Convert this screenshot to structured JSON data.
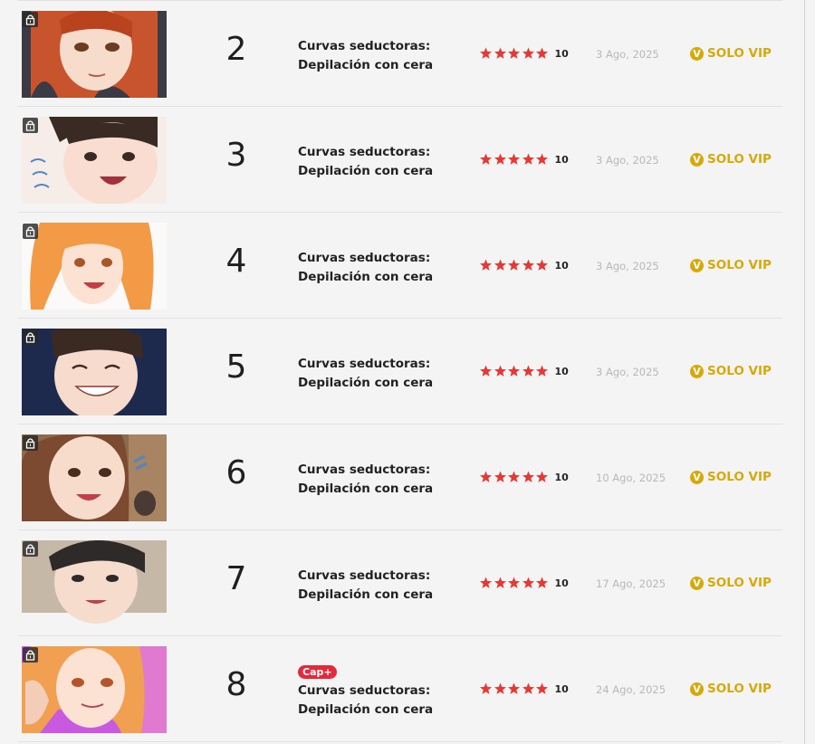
{
  "colors": {
    "background": "#f4f4f4",
    "star": "#e53935",
    "vip": "#d6a909",
    "badge": "#e5293b",
    "date": "#b8b8b8"
  },
  "icons": {
    "lock": "lock-icon",
    "star": "star-icon",
    "vip_coin": "vip-coin-icon"
  },
  "chapters": [
    {
      "number": "2",
      "title_line1": "Curvas seductoras:",
      "title_line2": "Depilación con cera",
      "rating": "10",
      "date": "3 Ago, 2025",
      "access": "SOLO VIP",
      "coin": "V",
      "badge": ""
    },
    {
      "number": "3",
      "title_line1": "Curvas seductoras:",
      "title_line2": "Depilación con cera",
      "rating": "10",
      "date": "3 Ago, 2025",
      "access": "SOLO VIP",
      "coin": "V",
      "badge": ""
    },
    {
      "number": "4",
      "title_line1": "Curvas seductoras:",
      "title_line2": "Depilación con cera",
      "rating": "10",
      "date": "3 Ago, 2025",
      "access": "SOLO VIP",
      "coin": "V",
      "badge": ""
    },
    {
      "number": "5",
      "title_line1": "Curvas seductoras:",
      "title_line2": "Depilación con cera",
      "rating": "10",
      "date": "3 Ago, 2025",
      "access": "SOLO VIP",
      "coin": "V",
      "badge": ""
    },
    {
      "number": "6",
      "title_line1": "Curvas seductoras:",
      "title_line2": "Depilación con cera",
      "rating": "10",
      "date": "10 Ago, 2025",
      "access": "SOLO VIP",
      "coin": "V",
      "badge": ""
    },
    {
      "number": "7",
      "title_line1": "Curvas seductoras:",
      "title_line2": "Depilación con cera",
      "rating": "10",
      "date": "17 Ago, 2025",
      "access": "SOLO VIP",
      "coin": "V",
      "badge": ""
    },
    {
      "number": "8",
      "title_line1": "Curvas seductoras:",
      "title_line2": "Depilación con cera",
      "rating": "10",
      "date": "24 Ago, 2025",
      "access": "SOLO VIP",
      "coin": "V",
      "badge": "Cap+"
    }
  ]
}
